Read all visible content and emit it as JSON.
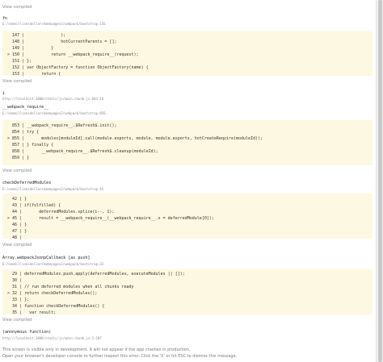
{
  "view_compiled": "View compiled",
  "frames": [
    {
      "name": "fn",
      "path": "E:/onemillionsdollarshomepagev2/webpack/bootstrap:156"
    },
    {
      "name": "i",
      "path": "http://localhost:3000/static/js/main.chunk.js:603:16"
    },
    {
      "name": "__webpack_require__",
      "path": "E:/onemillionsdollarshomepagev2/webpack/bootstrap:856"
    },
    {
      "name": "checkDeferredModules",
      "path": "E:/onemillionsdollarshomepagev2/webpack/bootstrap:45"
    },
    {
      "name": "Array.webpackJsonpCallback [as push]",
      "path": "E:/onemillionsdollarshomepagev2/webpack/bootstrap:32"
    },
    {
      "name": "(anonymous function)",
      "path": "http://localhost:3000/static/js/main.chunk.js:1:107"
    }
  ],
  "block1": [
    "  147 |               );",
    "  148 |               hotCurrentParents = [];",
    "  149 |           }",
    "> 150 |           return __webpack_require__(request);",
    "  151 | };",
    "  152 | var ObjectFactory = function ObjectFactory(name) {",
    "  153 |       return {"
  ],
  "block2": [
    "  853 | __webpack_require__.$Refresh$.init();",
    "  854 | try {",
    "> 855 |       modules[moduleId].call(module.exports, module, module.exports, hotCreateRequire(moduleId));",
    "  857 | } finally {",
    "  858 |       __webpack_require__.$Refresh$.cleanup(moduleId);",
    "  859 | }"
  ],
  "block3": [
    "  42 | }",
    "  43 | if(fulfilled) {",
    "  44 |       deferredModules.splice(i--, 1);",
    "> 45 |       result = __webpack_require__(__webpack_require__.s = deferredModule[0]);",
    "  46 | }",
    "  47 | }",
    "  48 |"
  ],
  "block4": [
    "  29 | deferredModules.push.apply(deferredModules, executeModules || []);",
    "  30 |",
    "  31 | // run deferred modules when all chunks ready",
    "> 32 | return checkDeferredModules();",
    "  33 | };",
    "  34 | function checkDeferredModules() {",
    "  35 |   var result;"
  ],
  "footer": {
    "line1": "This screen is visible only in development. It will not appear if the app crashes in production.",
    "line2": "Open your browser's developer console to further inspect this error.  Click the 'X' or hit ESC to dismiss this message."
  }
}
